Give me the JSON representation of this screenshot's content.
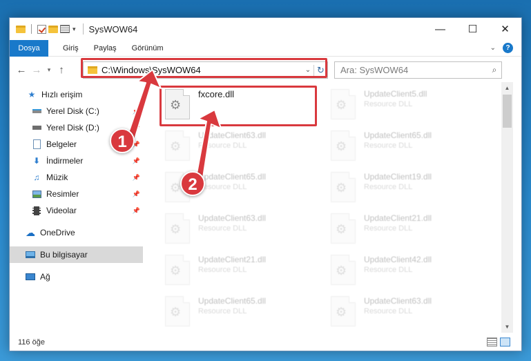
{
  "window": {
    "title": "SysWOW64"
  },
  "titlebar": {
    "minimize_glyph": "—",
    "maximize_glyph": "☐",
    "close_glyph": "✕"
  },
  "ribbon": {
    "tabs": [
      {
        "label": "Dosya",
        "active": true
      },
      {
        "label": "Giriş"
      },
      {
        "label": "Paylaş"
      },
      {
        "label": "Görünüm"
      }
    ],
    "help_label": "?"
  },
  "nav": {
    "address": "C:\\Windows\\SysWOW64",
    "search_placeholder": "Ara: SysWOW64"
  },
  "sidebar": {
    "items": [
      {
        "label": "Hızlı erişim",
        "icon": "star-icon"
      },
      {
        "label": "Yerel Disk (C:)",
        "icon": "drive-icon",
        "pinned": true
      },
      {
        "label": "Yerel Disk (D:)",
        "icon": "drive-icon",
        "pinned": true
      },
      {
        "label": "Belgeler",
        "icon": "documents-icon",
        "pinned": true
      },
      {
        "label": "İndirmeler",
        "icon": "download-icon",
        "pinned": true
      },
      {
        "label": "Müzik",
        "icon": "music-icon",
        "pinned": true
      },
      {
        "label": "Resimler",
        "icon": "pictures-icon",
        "pinned": true
      },
      {
        "label": "Videolar",
        "icon": "video-icon",
        "pinned": true
      },
      {
        "label": "OneDrive",
        "icon": "cloud-icon"
      },
      {
        "label": "Bu bilgisayar",
        "icon": "computer-icon",
        "selected": true
      },
      {
        "label": "Ağ",
        "icon": "network-icon"
      }
    ]
  },
  "files": [
    {
      "name": "fxcore.dll",
      "type": "",
      "highlight": true
    },
    {
      "name": "UpdateClient5.dll",
      "type": "Resource DLL"
    },
    {
      "name": "UpdateClient63.dll",
      "type": "Resource DLL"
    },
    {
      "name": "UpdateClient65.dll",
      "type": "Resource DLL"
    },
    {
      "name": "UpdateClient65.dll",
      "type": "Resource DLL"
    },
    {
      "name": "UpdateClient19.dll",
      "type": "Resource DLL"
    },
    {
      "name": "UpdateClient63.dll",
      "type": "Resource DLL"
    },
    {
      "name": "UpdateClient21.dll",
      "type": "Resource DLL"
    },
    {
      "name": "UpdateClient21.dll",
      "type": "Resource DLL"
    },
    {
      "name": "UpdateClient42.dll",
      "type": "Resource DLL"
    },
    {
      "name": "UpdateClient65.dll",
      "type": "Resource DLL"
    },
    {
      "name": "UpdateClient63.dll",
      "type": "Resource DLL"
    }
  ],
  "status": {
    "item_count": "116 öğe"
  },
  "annotations": {
    "step1": "1",
    "step2": "2",
    "color": "#d9393e"
  }
}
